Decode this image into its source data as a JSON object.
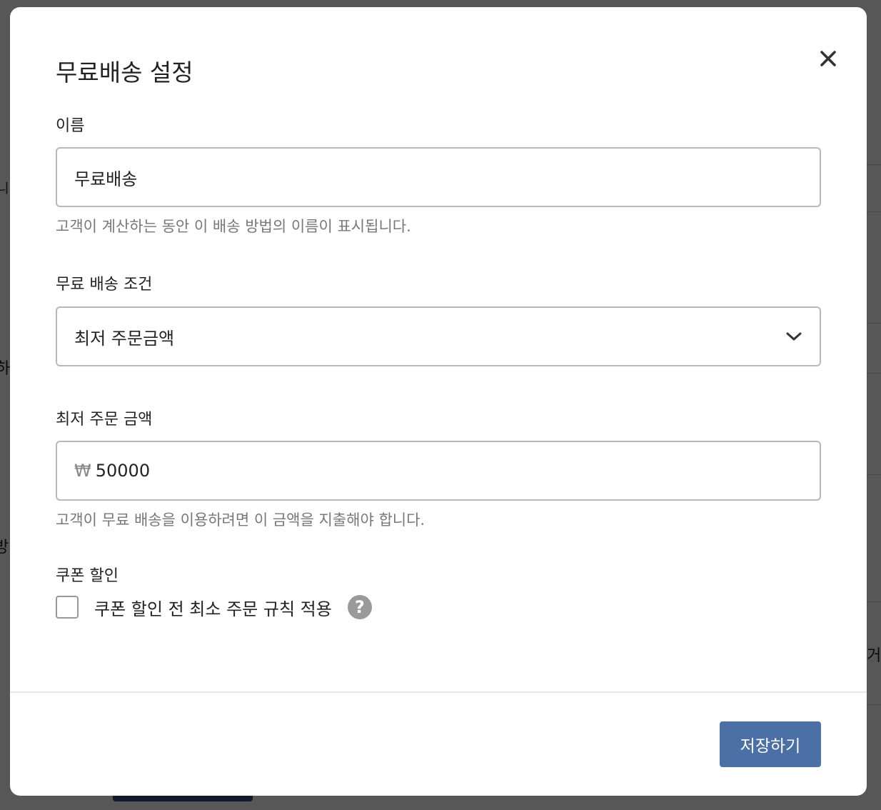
{
  "background": {
    "fragments": [
      "니",
      "하시",
      "방",
      "거"
    ]
  },
  "modal": {
    "title": "무료배송 설정",
    "close_icon": "close-icon",
    "name_field": {
      "label": "이름",
      "value": "무료배송",
      "help": "고객이 계산하는 동안 이 배송 방법의 이름이 표시됩니다."
    },
    "condition_field": {
      "label": "무료 배송 조건",
      "selected": "최저 주문금액",
      "icon": "chevron-down-icon"
    },
    "min_amount_field": {
      "label": "최저 주문 금액",
      "currency": "₩",
      "value": "50000",
      "help": "고객이 무료 배송을 이용하려면 이 금액을 지출해야 합니다."
    },
    "coupon": {
      "label": "쿠폰 할인",
      "checkbox_label": "쿠폰 할인 전 최소 주문 규칙 적용",
      "checked": false,
      "help_icon_glyph": "?"
    },
    "save_label": "저장하기"
  },
  "colors": {
    "accent": "#4b70a6",
    "overlay": "#575757",
    "border": "#b8b8b8",
    "help_text": "#777777"
  }
}
